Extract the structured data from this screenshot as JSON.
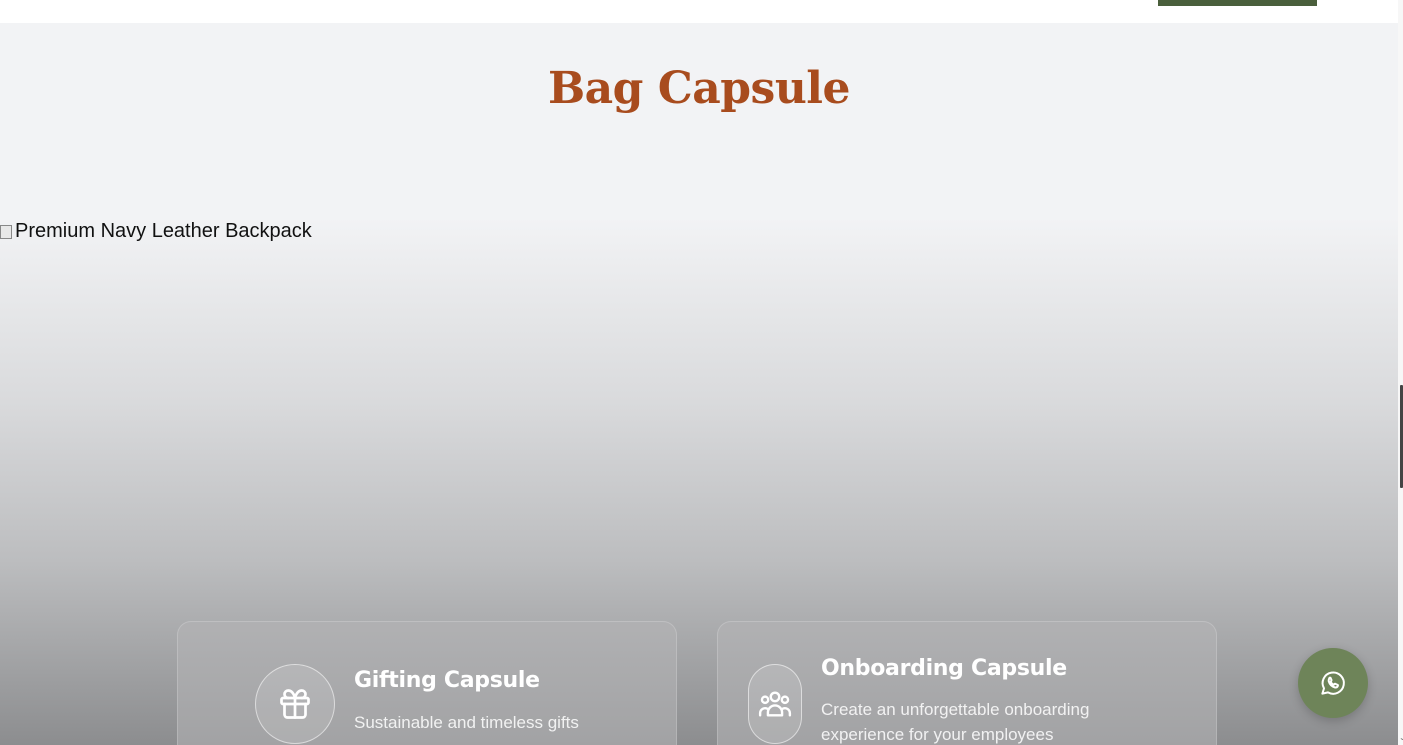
{
  "header": {
    "cta_color": "#4a5f3c"
  },
  "section": {
    "title": "Bag Capsule",
    "hero_image_alt": "Premium Navy Leather Backpack"
  },
  "cards": [
    {
      "icon": "gift-icon",
      "title": "Gifting Capsule",
      "description": "Sustainable and timeless gifts"
    },
    {
      "icon": "users-icon",
      "title": "Onboarding Capsule",
      "description": "Create an unforgettable onboarding experience for your employees"
    }
  ],
  "whatsapp": {
    "icon": "whatsapp-icon",
    "color": "#6e8459"
  },
  "colors": {
    "title": "#a84c1e",
    "background": "#f2f3f5"
  }
}
